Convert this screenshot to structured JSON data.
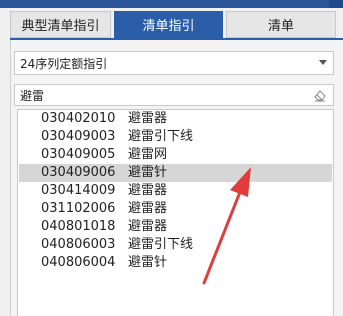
{
  "tabs": [
    {
      "label": "典型清单指引",
      "active": false
    },
    {
      "label": "清单指引",
      "active": true
    },
    {
      "label": "清单",
      "active": false
    }
  ],
  "selector": {
    "value": "24序列定额指引"
  },
  "search": {
    "value": "避雷"
  },
  "list": {
    "items": [
      {
        "code": "030402010",
        "name": "避雷器"
      },
      {
        "code": "030409003",
        "name": "避雷引下线"
      },
      {
        "code": "030409005",
        "name": "避雷网"
      },
      {
        "code": "030409006",
        "name": "避雷针"
      },
      {
        "code": "030414009",
        "name": "避雷器"
      },
      {
        "code": "031102006",
        "name": "避雷器"
      },
      {
        "code": "040801018",
        "name": "避雷器"
      },
      {
        "code": "040806003",
        "name": "避雷引下线"
      },
      {
        "code": "040806004",
        "name": "避雷针"
      }
    ],
    "selected_index": 3
  },
  "colors": {
    "accent": "#2b5ea8",
    "arrow": "#e03c3c",
    "selection": "#d6d6d6"
  },
  "icons": {
    "dropdown": "chevron-down-icon",
    "clear": "eraser-icon",
    "annotation": "arrow-annotation"
  }
}
